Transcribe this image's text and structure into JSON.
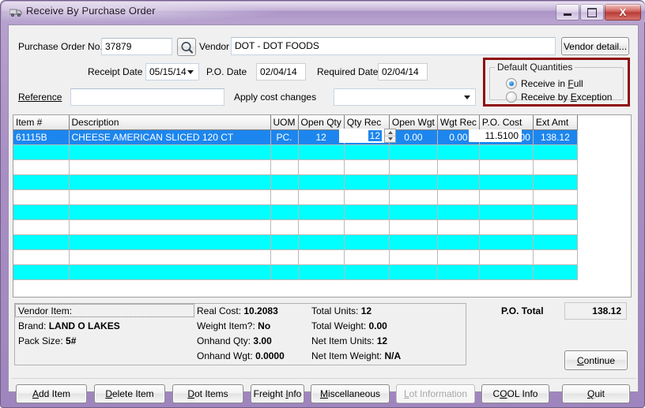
{
  "window": {
    "title": "Receive By Purchase Order",
    "icon": "truck-icon",
    "minimize_label": "–",
    "maximize_label": "□",
    "close_label": "X"
  },
  "form": {
    "po_no_label": "Purchase Order No.",
    "po_no_value": "37879",
    "search_icon": "magnifier-icon",
    "vendor_label": "Vendor",
    "vendor_value": "DOT - DOT FOODS",
    "vendor_detail_button": "Vendor detail...",
    "receipt_date_label": "Receipt Date",
    "receipt_date_value": "05/15/14",
    "po_date_label": "P.O. Date",
    "po_date_value": "02/04/14",
    "required_date_label": "Required Date",
    "required_date_value": "02/04/14",
    "reference_label": "Reference",
    "reference_value": "",
    "apply_cost_changes_label": "Apply cost changes",
    "apply_cost_changes_value": ""
  },
  "default_quantities": {
    "legend": "Default Quantities",
    "border_color": "#8f0d0d",
    "options": [
      {
        "label": "Receive in Full",
        "selected": true
      },
      {
        "label": "Receive by Exception",
        "selected": false
      }
    ]
  },
  "grid": {
    "columns": [
      "Item #",
      "Description",
      "UOM",
      "Open Qty",
      "Qty Rec",
      "Open Wgt",
      "Wgt Rec",
      "P.O. Cost",
      "Ext Amt"
    ],
    "rows": [
      {
        "selected": true,
        "item": "61115B",
        "description": "CHEESE AMERICAN SLICED 120 CT",
        "uom": "PC.",
        "open_qty": "12",
        "qty_rec": "12",
        "open_wgt": "0.00",
        "wgt_rec": "0.00",
        "po_cost": "11.5100",
        "ext_amt": "138.12"
      }
    ],
    "empty_row_count": 9,
    "editing": {
      "qty_rec_value": "12",
      "po_cost_value": "11.5100",
      "spinner_up": "▲",
      "spinner_down": "▼"
    },
    "row_colors": {
      "selected": "#1c86ee",
      "alt": "#00ffff",
      "base": "#ffffff"
    }
  },
  "item_info": {
    "left": [
      {
        "label": "Vendor Item:",
        "value": ""
      },
      {
        "label": "Brand:",
        "value": "LAND O LAKES"
      },
      {
        "label": "Pack Size:",
        "value": "5#"
      }
    ],
    "middle": [
      {
        "label": "Real Cost:",
        "value": "10.2083"
      },
      {
        "label": "Weight Item?:",
        "value": "No"
      },
      {
        "label": "Onhand Qty:",
        "value": "3.00"
      },
      {
        "label": "Onhand Wgt:",
        "value": "0.0000"
      }
    ],
    "right": [
      {
        "label": "Total Units:",
        "value": "12"
      },
      {
        "label": "Total Weight:",
        "value": "0.00"
      },
      {
        "label": "Net Item Units:",
        "value": "12"
      },
      {
        "label": "Net Item Weight:",
        "value": "N/A"
      }
    ]
  },
  "totals": {
    "po_total_label": "P.O. Total",
    "po_total_value": "138.12"
  },
  "actions": {
    "continue": "Continue",
    "buttons": [
      {
        "label": "Add Item",
        "accel": "A",
        "disabled": false
      },
      {
        "label": "Delete Item",
        "accel": "D",
        "disabled": false
      },
      {
        "label": "Dot Items",
        "accel": "D",
        "disabled": false
      },
      {
        "label": "Freight Info",
        "accel": "I",
        "disabled": false
      },
      {
        "label": "Miscellaneous",
        "accel": "M",
        "disabled": false
      },
      {
        "label": "Lot Information",
        "accel": "L",
        "disabled": true
      },
      {
        "label": "COOL Info",
        "accel": "O",
        "disabled": false
      },
      {
        "label": "Quit",
        "accel": "Q",
        "disabled": false
      }
    ]
  }
}
